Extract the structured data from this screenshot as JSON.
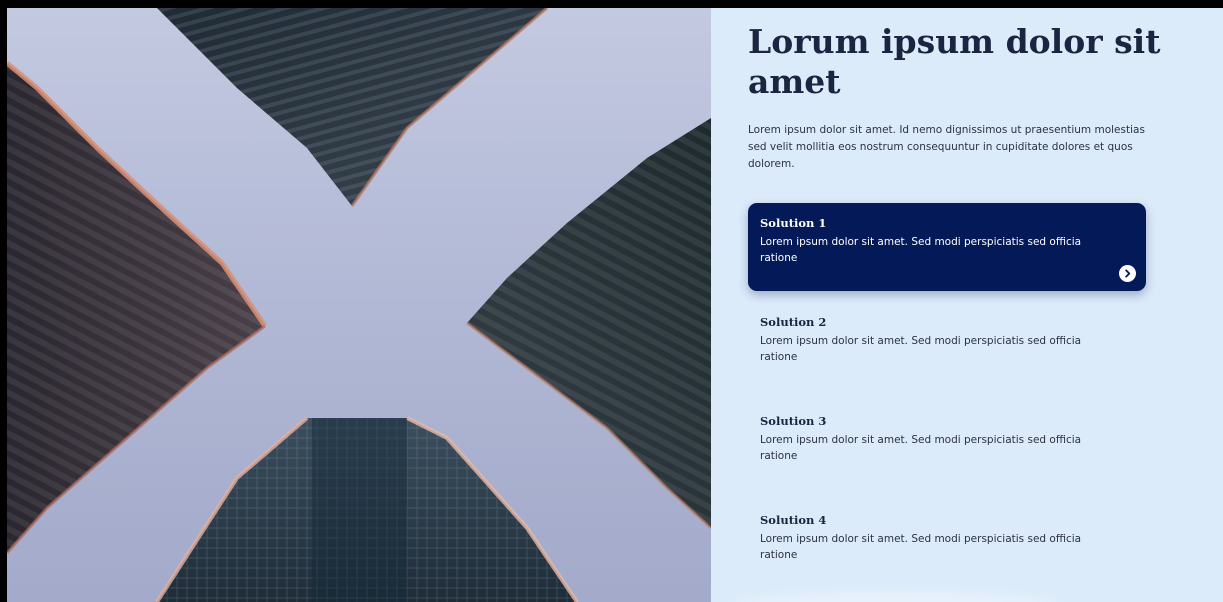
{
  "hero": {
    "image_alt": "",
    "title": "Lorum ipsum dolor sit amet",
    "intro": "Lorem ipsum dolor sit amet. Id nemo dignissimos ut praesentium molestias sed velit mollitia eos nostrum consequuntur in cupiditate dolores et quos dolorem."
  },
  "solutions": [
    {
      "title": "Solution 1",
      "description": "Lorem ipsum dolor sit amet. Sed modi perspiciatis sed officia ratione",
      "active": true
    },
    {
      "title": "Solution 2",
      "description": "Lorem ipsum dolor sit amet. Sed modi perspiciatis sed officia ratione",
      "active": false
    },
    {
      "title": "Solution 3",
      "description": "Lorem ipsum dolor sit amet. Sed modi perspiciatis sed officia ratione",
      "active": false
    },
    {
      "title": "Solution 4",
      "description": "Lorem ipsum dolor sit amet. Sed modi perspiciatis sed officia ratione",
      "active": false
    }
  ],
  "icons": {
    "active_arrow": "chevron-right-icon"
  },
  "colors": {
    "panel_background": "#dcebfa",
    "active_card": "#041a58",
    "heading_text": "#1b2440"
  }
}
